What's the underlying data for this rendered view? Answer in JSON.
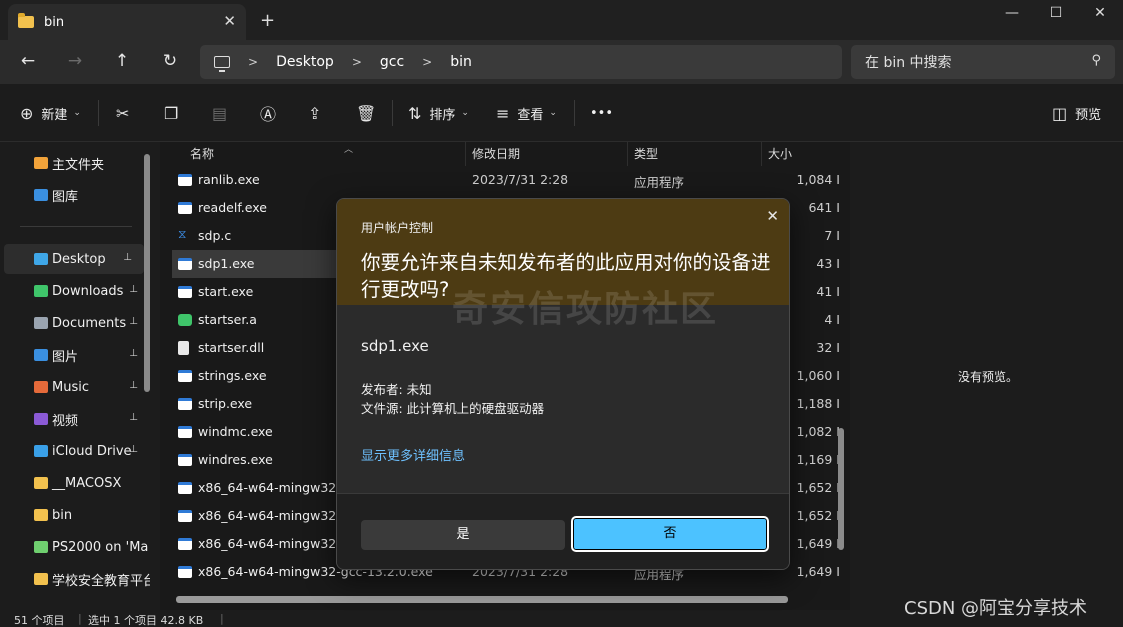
{
  "window": {
    "tab_title": "bin",
    "tab_close": "✕",
    "new_tab": "+",
    "minimize": "—",
    "maximize": "☐",
    "close": "✕"
  },
  "nav": {
    "back_icon": "←",
    "forward_icon": "→",
    "up_icon": "↑",
    "refresh_icon": "↻",
    "breadcrumb": [
      "Desktop",
      "gcc",
      "bin"
    ],
    "separator": ">",
    "search_placeholder": "在 bin 中搜索"
  },
  "toolbar": {
    "new_label": "新建",
    "sort_label": "排序",
    "view_label": "查看",
    "more_label": "•••",
    "preview_label": "预览"
  },
  "sidebar": {
    "items": [
      {
        "label": "主文件夹",
        "icon": "home-icon",
        "color": "#f2a33a",
        "pinned": false
      },
      {
        "label": "图库",
        "icon": "gallery-icon",
        "color": "#3a8fe0",
        "pinned": false
      },
      {
        "label": "Desktop",
        "icon": "desktop-icon",
        "color": "#3fa7e8",
        "pinned": true
      },
      {
        "label": "Downloads",
        "icon": "download-icon",
        "color": "#3fc56a",
        "pinned": true
      },
      {
        "label": "Documents",
        "icon": "document-icon",
        "color": "#9aa4b0",
        "pinned": true
      },
      {
        "label": "图片",
        "icon": "pictures-icon",
        "color": "#3a8fe0",
        "pinned": true
      },
      {
        "label": "Music",
        "icon": "music-icon",
        "color": "#e56a3a",
        "pinned": true
      },
      {
        "label": "视频",
        "icon": "video-icon",
        "color": "#8b5ad6",
        "pinned": true
      },
      {
        "label": "iCloud Drive",
        "icon": "folder-icon",
        "color": "#3aa0e8",
        "pinned": true
      },
      {
        "label": "__MACOSX",
        "icon": "folder-icon",
        "color": "#f2c14e",
        "pinned": false
      },
      {
        "label": "bin",
        "icon": "folder-icon",
        "color": "#f2c14e",
        "pinned": false
      },
      {
        "label": "PS2000 on 'Ma",
        "icon": "drive-icon",
        "color": "#6fcf6f",
        "pinned": false
      },
      {
        "label": "学校安全教育平台",
        "icon": "folder-icon",
        "color": "#f2c14e",
        "pinned": false
      }
    ],
    "pin_glyph": "📌"
  },
  "columns": {
    "name": "名称",
    "date": "修改日期",
    "type": "类型",
    "size": "大小"
  },
  "files": [
    {
      "name": "ranlib.exe",
      "date": "2023/7/31 2:28",
      "type": "应用程序",
      "size": "1,084 I",
      "kind": "exe"
    },
    {
      "name": "readelf.exe",
      "date": "",
      "type": "",
      "size": "641 I",
      "kind": "exe"
    },
    {
      "name": "sdp.c",
      "date": "",
      "type": "",
      "size": "7 I",
      "kind": "c"
    },
    {
      "name": "sdp1.exe",
      "date": "",
      "type": "",
      "size": "43 I",
      "kind": "exe"
    },
    {
      "name": "start.exe",
      "date": "",
      "type": "",
      "size": "41 I",
      "kind": "exe"
    },
    {
      "name": "startser.a",
      "date": "",
      "type": "",
      "size": "4 I",
      "kind": "a"
    },
    {
      "name": "startser.dll",
      "date": "",
      "type": "",
      "size": "32 I",
      "kind": "dll"
    },
    {
      "name": "strings.exe",
      "date": "",
      "type": "",
      "size": "1,060 I",
      "kind": "exe"
    },
    {
      "name": "strip.exe",
      "date": "",
      "type": "",
      "size": "1,188 I",
      "kind": "exe"
    },
    {
      "name": "windmc.exe",
      "date": "",
      "type": "",
      "size": "1,082 I",
      "kind": "exe"
    },
    {
      "name": "windres.exe",
      "date": "",
      "type": "",
      "size": "1,169 I",
      "kind": "exe"
    },
    {
      "name": "x86_64-w64-mingw32-c",
      "date": "",
      "type": "",
      "size": "1,652 I",
      "kind": "exe"
    },
    {
      "name": "x86_64-w64-mingw32-g",
      "date": "",
      "type": "",
      "size": "1,652 I",
      "kind": "exe"
    },
    {
      "name": "x86_64-w64-mingw32-g",
      "date": "",
      "type": "",
      "size": "1,649 I",
      "kind": "exe"
    },
    {
      "name": "x86_64-w64-mingw32-gcc-13.2.0.exe",
      "date": "2023/7/31 2:28",
      "type": "应用程序",
      "size": "1,649 I",
      "kind": "exe"
    }
  ],
  "preview": {
    "empty_text": "没有预览。"
  },
  "status": {
    "count": "51 个项目",
    "selection": "选中 1 个项目  42.8 KB"
  },
  "uac": {
    "title": "用户帐户控制",
    "close_icon": "✕",
    "question": "你要允许来自未知发布者的此应用对你的设备进行更改吗?",
    "app_name": "sdp1.exe",
    "publisher": "发布者: 未知",
    "source": "文件源: 此计算机上的硬盘驱动器",
    "details_link": "显示更多详细信息",
    "yes_label": "是",
    "no_label": "否"
  },
  "watermarks": {
    "site": "奇安信攻防社区",
    "csdn": "CSDN @阿宝分享技术"
  }
}
